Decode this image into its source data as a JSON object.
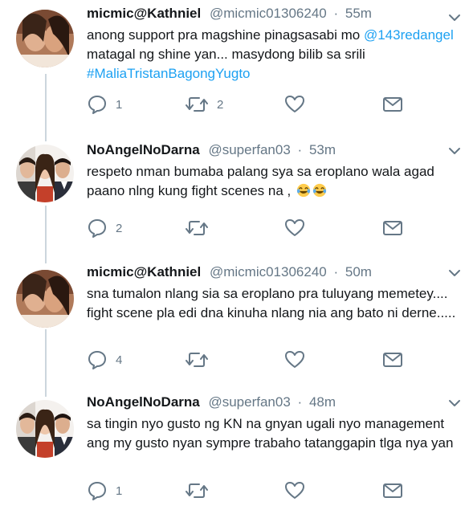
{
  "tweets": [
    {
      "name": "micmic@Kathniel",
      "handle": "@micmic01306240",
      "time": "55m",
      "text_parts": [
        "anong support pra magshine pinagsasabi mo ",
        "@143redangel",
        " matagal ng shine yan... masydong bilib sa srili ",
        "#MaliaTristanBagongYugto"
      ],
      "replies": "1",
      "retweets": "2",
      "likes": ""
    },
    {
      "name": "NoAngelNoDarna",
      "handle": "@superfan03",
      "time": "53m",
      "text": "respeto nman bumaba palang sya sa eroplano wala agad paano nlng kung fight scenes na ,",
      "emoji": [
        "face-with-tears-of-joy-icon",
        "face-with-tears-of-joy-icon"
      ],
      "replies": "2",
      "retweets": "",
      "likes": ""
    },
    {
      "name": "micmic@Kathniel",
      "handle": "@micmic01306240",
      "time": "50m",
      "text": "sna tumalon nlang sia sa eroplano pra tuluyang memetey.... fight scene pla edi dna kinuha nlang nia ang bato ni derne.....",
      "replies": "4",
      "retweets": "",
      "likes": ""
    },
    {
      "name": "NoAngelNoDarna",
      "handle": "@superfan03",
      "time": "48m",
      "text": "sa tingin nyo gusto ng KN na gnyan ugali nyo management ang my gusto nyan sympre trabaho tatanggapin tlga nya yan",
      "replies": "1",
      "retweets": "",
      "likes": ""
    }
  ],
  "colors": {
    "link": "#1da1f2",
    "secondary_text": "#657786",
    "icon": "#657786",
    "thread_line": "#ccd6dd"
  },
  "separator": "·"
}
